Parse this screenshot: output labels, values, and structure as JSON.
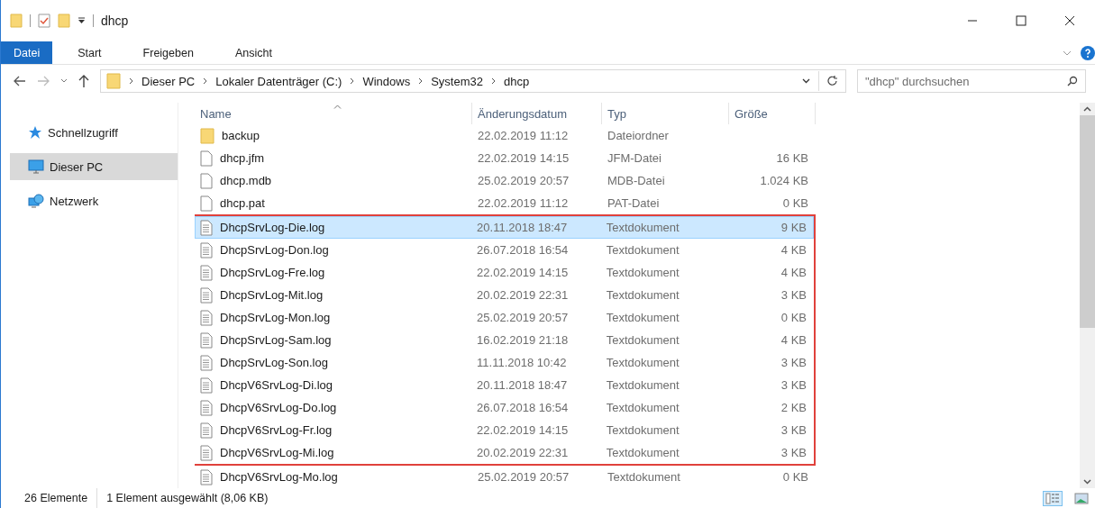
{
  "window": {
    "title": "dhcp"
  },
  "ribbon": {
    "tabs": [
      {
        "label": "Datei",
        "kind": "file",
        "selected": false
      },
      {
        "label": "Start",
        "kind": "tab",
        "selected": false
      },
      {
        "label": "Freigeben",
        "kind": "tab",
        "selected": false
      },
      {
        "label": "Ansicht",
        "kind": "tab",
        "selected": false
      }
    ]
  },
  "address_bar": {
    "path": [
      "Dieser PC",
      "Lokaler Datenträger (C:)",
      "Windows",
      "System32",
      "dhcp"
    ]
  },
  "search": {
    "placeholder": "\"dhcp\" durchsuchen"
  },
  "sidebar": {
    "items": [
      {
        "label": "Schnellzugriff",
        "kind": "star",
        "selected": false
      },
      {
        "label": "Dieser PC",
        "kind": "pc",
        "selected": true
      },
      {
        "label": "Netzwerk",
        "kind": "network",
        "selected": false
      }
    ]
  },
  "table": {
    "columns": [
      {
        "label": "Name",
        "sorted": true
      },
      {
        "label": "Änderungsdatum",
        "sorted": false
      },
      {
        "label": "Typ",
        "sorted": false
      },
      {
        "label": "Größe",
        "sorted": false
      }
    ],
    "sections": [
      {
        "kind": "plain",
        "rows": [
          {
            "kind": "folder",
            "name": "backup",
            "date": "22.02.2019 11:12",
            "type": "Dateiordner",
            "selected": false
          },
          {
            "kind": "file",
            "name": "dhcp.jfm",
            "date": "22.02.2019 14:15",
            "type": "JFM-Datei",
            "size": "16 KB",
            "selected": false
          },
          {
            "kind": "file",
            "name": "dhcp.mdb",
            "date": "25.02.2019 20:57",
            "type": "MDB-Datei",
            "size": "1.024 KB",
            "selected": false
          },
          {
            "kind": "file",
            "name": "dhcp.pat",
            "date": "22.02.2019 11:12",
            "type": "PAT-Datei",
            "size": "0 KB",
            "selected": false
          }
        ]
      },
      {
        "kind": "framed",
        "rows": [
          {
            "kind": "text",
            "name": "DhcpSrvLog-Die.log",
            "date": "20.11.2018 18:47",
            "type": "Textdokument",
            "size": "9 KB",
            "selected": true
          },
          {
            "kind": "text",
            "name": "DhcpSrvLog-Don.log",
            "date": "26.07.2018 16:54",
            "type": "Textdokument",
            "size": "4 KB",
            "selected": false
          },
          {
            "kind": "text",
            "name": "DhcpSrvLog-Fre.log",
            "date": "22.02.2019 14:15",
            "type": "Textdokument",
            "size": "4 KB",
            "selected": false
          },
          {
            "kind": "text",
            "name": "DhcpSrvLog-Mit.log",
            "date": "20.02.2019 22:31",
            "type": "Textdokument",
            "size": "3 KB",
            "selected": false
          },
          {
            "kind": "text",
            "name": "DhcpSrvLog-Mon.log",
            "date": "25.02.2019 20:57",
            "type": "Textdokument",
            "size": "0 KB",
            "selected": false
          },
          {
            "kind": "text",
            "name": "DhcpSrvLog-Sam.log",
            "date": "16.02.2019 21:18",
            "type": "Textdokument",
            "size": "4 KB",
            "selected": false
          },
          {
            "kind": "text",
            "name": "DhcpSrvLog-Son.log",
            "date": "11.11.2018 10:42",
            "type": "Textdokument",
            "size": "3 KB",
            "selected": false
          },
          {
            "kind": "text",
            "name": "DhcpV6SrvLog-Di.log",
            "date": "20.11.2018 18:47",
            "type": "Textdokument",
            "size": "3 KB",
            "selected": false
          },
          {
            "kind": "text",
            "name": "DhcpV6SrvLog-Do.log",
            "date": "26.07.2018 16:54",
            "type": "Textdokument",
            "size": "2 KB",
            "selected": false
          },
          {
            "kind": "text",
            "name": "DhcpV6SrvLog-Fr.log",
            "date": "22.02.2019 14:15",
            "type": "Textdokument",
            "size": "3 KB",
            "selected": false
          },
          {
            "kind": "text",
            "name": "DhcpV6SrvLog-Mi.log",
            "date": "20.02.2019 22:31",
            "type": "Textdokument",
            "size": "3 KB",
            "selected": false
          }
        ]
      },
      {
        "kind": "plain",
        "rows": [
          {
            "kind": "text",
            "name": "DhcpV6SrvLog-Mo.log",
            "date": "25.02.2019 20:57",
            "type": "Textdokument",
            "size": "0 KB",
            "selected": false
          }
        ]
      }
    ]
  },
  "status_bar": {
    "count": "26 Elemente",
    "selection": "1 Element ausgewählt (8,06 KB)",
    "views": [
      {
        "kind": "details",
        "selected": true
      },
      {
        "kind": "tiles",
        "selected": false
      }
    ]
  }
}
